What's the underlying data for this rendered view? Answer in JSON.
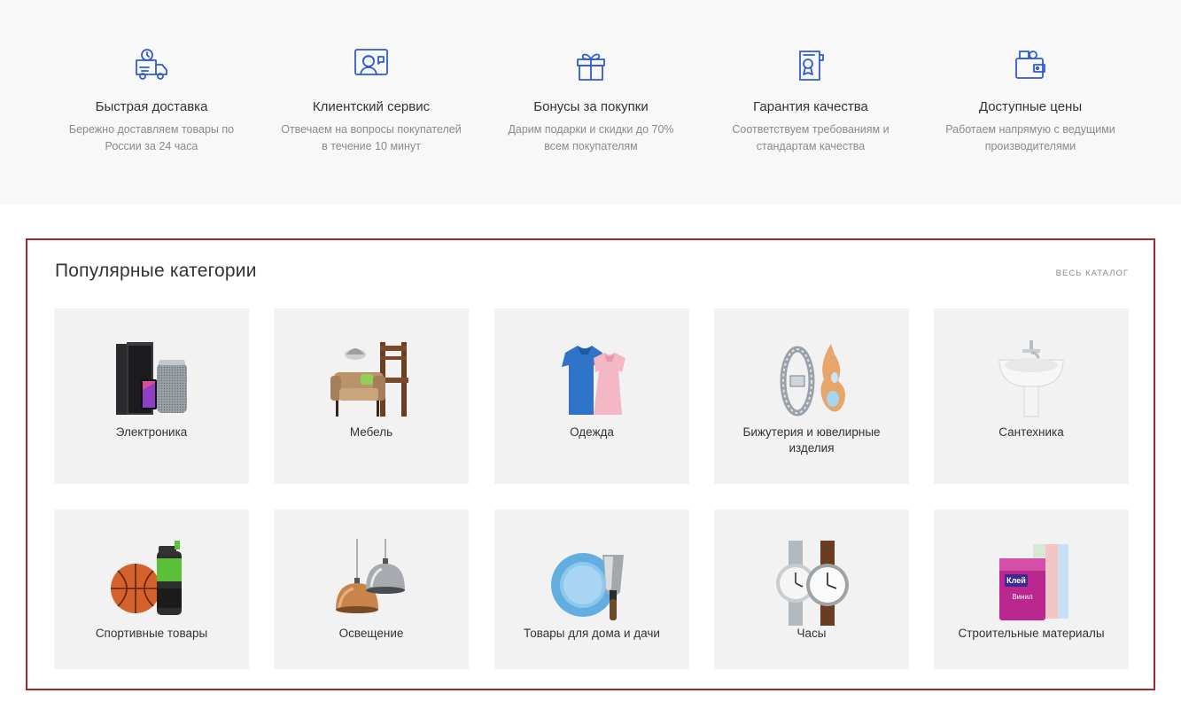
{
  "features": [
    {
      "icon": "delivery-truck-icon",
      "title": "Быстрая доставка",
      "desc_line1": "Бережно доставляем товары по",
      "desc_line2": "России за 24 часа"
    },
    {
      "icon": "support-agent-icon",
      "title": "Клиентский сервис",
      "desc_line1": "Отвечаем на вопросы покупателей",
      "desc_line2": "в течение 10 минут"
    },
    {
      "icon": "gift-icon",
      "title": "Бонусы за покупки",
      "desc_line1": "Дарим подарки и скидки до 70%",
      "desc_line2": "всем покупателям"
    },
    {
      "icon": "certificate-icon",
      "title": "Гарантия качества",
      "desc_line1": "Соответствуем требованиям и",
      "desc_line2": "стандартам качества"
    },
    {
      "icon": "wallet-icon",
      "title": "Доступные цены",
      "desc_line1": "Работаем напрямую с ведущими",
      "desc_line2": "производителями"
    }
  ],
  "popular": {
    "title": "Популярные категории",
    "catalog_link": "ВЕСЬ КАТАЛОГ",
    "categories": [
      {
        "label": "Электроника",
        "image": "electronics-image"
      },
      {
        "label": "Мебель",
        "image": "furniture-image"
      },
      {
        "label": "Одежда",
        "image": "clothing-image"
      },
      {
        "label": "Бижутерия и ювелирные изделия",
        "image": "jewelry-image"
      },
      {
        "label": "Сантехника",
        "image": "sink-image"
      },
      {
        "label": "Спортивные товары",
        "image": "sports-image"
      },
      {
        "label": "Освещение",
        "image": "lamps-image"
      },
      {
        "label": "Товары для дома и дачи",
        "image": "home-garden-image"
      },
      {
        "label": "Часы",
        "image": "watches-image"
      },
      {
        "label": "Строительные материалы",
        "image": "building-materials-image"
      }
    ],
    "glue_label_1": "Клей",
    "glue_label_2": "Винил"
  },
  "colors": {
    "icon_blue": "#2f5bd4",
    "frame": "#a02a2a",
    "tile_bg": "#f2f2f2",
    "band_bg": "#f8f8f8"
  }
}
